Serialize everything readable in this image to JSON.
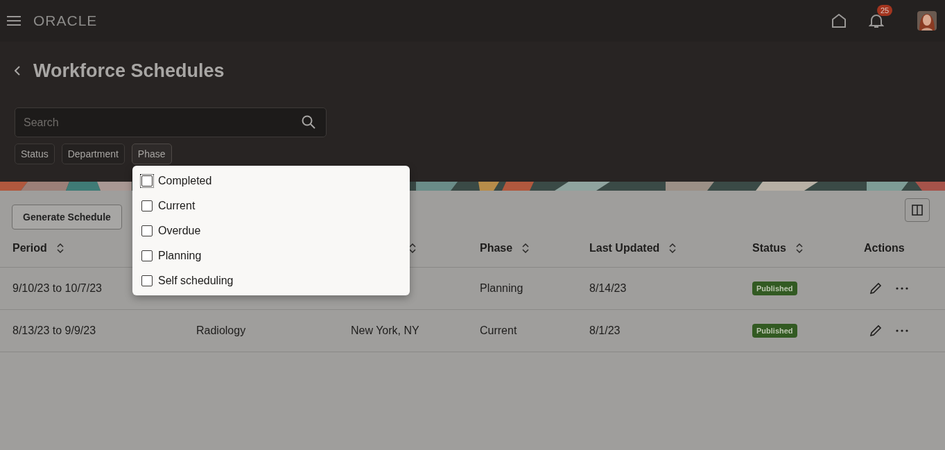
{
  "topbar": {
    "logo": "ORACLE",
    "notifications": "25"
  },
  "header": {
    "title": "Workforce Schedules",
    "search": {
      "placeholder": "Search"
    },
    "filters": [
      {
        "label": "Status",
        "selected": false
      },
      {
        "label": "Department",
        "selected": false
      },
      {
        "label": "Phase",
        "selected": true
      }
    ]
  },
  "phase_menu": {
    "options": [
      {
        "label": "Completed",
        "checked": false,
        "focused": true
      },
      {
        "label": "Current",
        "checked": false,
        "focused": false
      },
      {
        "label": "Overdue",
        "checked": false,
        "focused": false
      },
      {
        "label": "Planning",
        "checked": false,
        "focused": false
      },
      {
        "label": "Self scheduling",
        "checked": false,
        "focused": false
      }
    ]
  },
  "toolbar": {
    "button": "Generate Schedule"
  },
  "table": {
    "columns": [
      {
        "label": "Period",
        "sortable": true
      },
      {
        "sortable": true
      },
      {
        "label": "Phase",
        "sortable": true
      },
      {
        "label": "Last Updated",
        "sortable": true
      },
      {
        "label": "Status",
        "sortable": true
      },
      {
        "label": "Actions",
        "sortable": false
      }
    ],
    "rows": [
      {
        "period": "9/10/23 to 10/7/23",
        "phase": "Planning",
        "last_updated": "8/14/23",
        "status": "Published"
      },
      {
        "period": "8/13/23 to 9/9/23",
        "department": "Radiology",
        "location": "New York, NY",
        "phase": "Current",
        "last_updated": "8/1/23",
        "status": "Published"
      }
    ]
  }
}
